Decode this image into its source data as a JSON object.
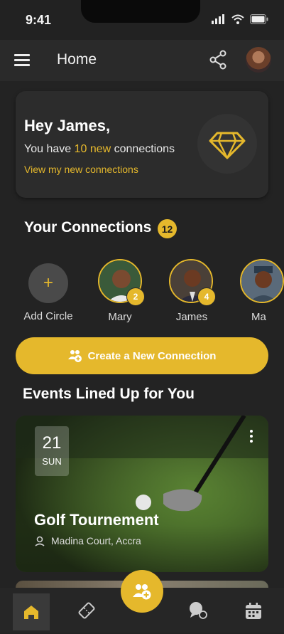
{
  "status_bar": {
    "time": "9:41"
  },
  "header": {
    "title": "Home"
  },
  "welcome": {
    "greeting": "Hey James,",
    "message_prefix": "You have ",
    "message_highlight": "10 new",
    "message_suffix": " connections",
    "link": "View my new connections"
  },
  "connections": {
    "title": "Your Connections",
    "count": "12",
    "add_label": "Add Circle",
    "people": [
      {
        "name": "Mary",
        "badge": "2"
      },
      {
        "name": "James",
        "badge": "4"
      },
      {
        "name": "Ma",
        "badge": ""
      }
    ]
  },
  "create_button": {
    "label": "Create a New Connection"
  },
  "events": {
    "title": "Events Lined Up for You",
    "items": [
      {
        "day": "21",
        "weekday": "SUN",
        "name": "Golf Tournement",
        "location": "Madina Court, Accra"
      }
    ]
  },
  "colors": {
    "accent": "#e5b82c",
    "background": "#232323",
    "card": "#2c2c2c"
  },
  "icons": [
    "menu-icon",
    "share-icon",
    "diamond-icon",
    "plus-icon",
    "add-group-icon",
    "location-icon",
    "more-vertical-icon",
    "home-icon",
    "ticket-icon",
    "chat-icon",
    "calendar-icon"
  ]
}
